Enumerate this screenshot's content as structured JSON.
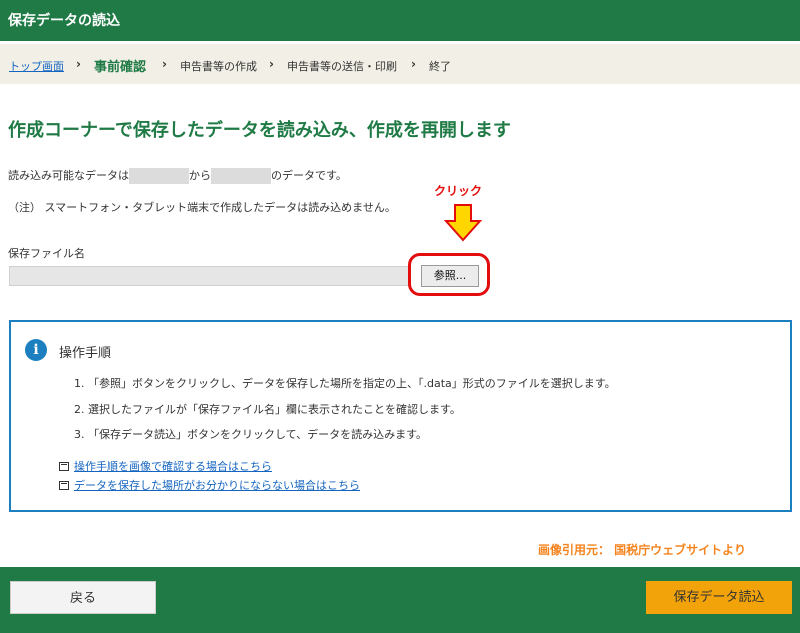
{
  "header": {
    "title": "保存データの読込"
  },
  "breadcrumb": {
    "items": [
      "トップ画面",
      "事前確認",
      "申告書等の作成",
      "申告書等の送信・印刷",
      "終了"
    ]
  },
  "main": {
    "title": "作成コーナーで保存したデータを読み込み、作成を再開します",
    "range_prefix": "読み込み可能なデータは",
    "range_middle": "から",
    "range_suffix": "のデータです。",
    "note": "（注） スマートフォン・タブレット端末で作成したデータは読み込めません。",
    "file_label": "保存ファイル名",
    "browse_label": "参照..."
  },
  "annotation": {
    "text": "クリック",
    "color": "#e30d0d"
  },
  "panel": {
    "title": "操作手順",
    "steps": [
      "1. 「参照」ボタンをクリックし、データを保存した場所を指定の上、「.data」形式のファイルを選択します。",
      "2. 選択したファイルが「保存ファイル名」欄に表示されたことを確認します。",
      "3. 「保存データ読込」ボタンをクリックして、データを読み込みます。"
    ],
    "links": [
      "操作手順を画像で確認する場合はこちら",
      "データを保存した場所がお分かりにならない場合はこちら"
    ]
  },
  "credit": "画像引用元： 国税庁ウェブサイトより",
  "footer": {
    "back_label": "戻る",
    "read_label": "保存データ読込"
  },
  "colors": {
    "brand_green": "#1f7a45",
    "accent_orange": "#f2a30a",
    "info_blue": "#1b7fc0",
    "link_blue": "#1565c0"
  }
}
